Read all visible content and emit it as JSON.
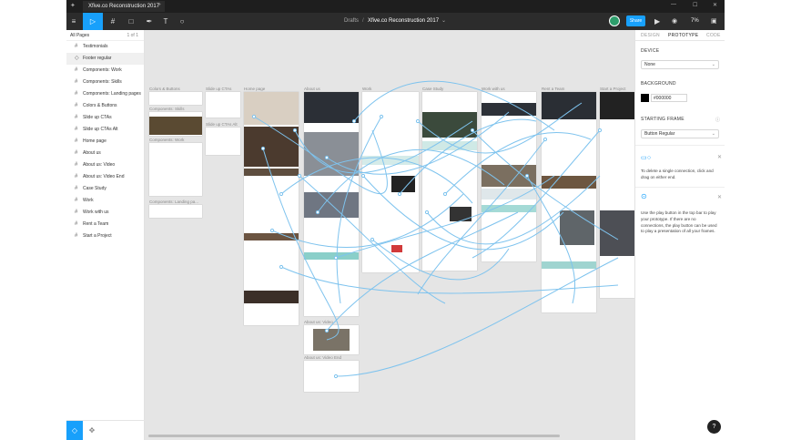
{
  "titlebar": {
    "tab_title": "Xfive.co Reconstruction 2017",
    "new_tab": "+",
    "minimize": "—",
    "maximize": "☐",
    "close": "✕"
  },
  "toolbar": {
    "breadcrumb_folder": "Drafts",
    "breadcrumb_sep": "/",
    "file_name": "Xfive.co Reconstruction 2017",
    "file_caret": "⌄",
    "share_label": "Share",
    "zoom": "7%"
  },
  "left_panel": {
    "pages_label": "All Pages",
    "pages_count": "1 of 1",
    "layers": [
      {
        "label": "Testimonials"
      },
      {
        "label": "Footer regular"
      },
      {
        "label": "Components: Work"
      },
      {
        "label": "Components: Skills"
      },
      {
        "label": "Components: Landing pages"
      },
      {
        "label": "Colors & Buttons"
      },
      {
        "label": "Slide up CTAs"
      },
      {
        "label": "Slide up CTAs Alt"
      },
      {
        "label": "Home page"
      },
      {
        "label": "About us"
      },
      {
        "label": "About us: Video"
      },
      {
        "label": "About us: Video End"
      },
      {
        "label": "Case Study"
      },
      {
        "label": "Work"
      },
      {
        "label": "Work with us"
      },
      {
        "label": "Rent a Team"
      },
      {
        "label": "Start a Project"
      }
    ]
  },
  "canvas": {
    "frame_labels": {
      "colors_buttons": "Colors & Buttons",
      "slide_up": "Slide up CTAs",
      "slide_up_alt": "Slide up CTAs Alt",
      "home": "Home page",
      "about": "About us",
      "work": "Work",
      "case_study": "Case Study",
      "work_with_us": "Work with us",
      "rent": "Rent a Team",
      "start": "Start a Project",
      "comp_skills": "Components: Skills",
      "comp_work": "Components: Work",
      "comp_landing": "Components: Landing pa...",
      "about_video": "About us: Video",
      "about_video_end": "About us: Video End"
    }
  },
  "right_panel": {
    "tabs": [
      "DESIGN",
      "PROTOTYPE",
      "CODE"
    ],
    "device_label": "DEVICE",
    "device_value": "None",
    "background_label": "BACKGROUND",
    "background_hex": "#000000",
    "starting_frame_label": "STARTING FRAME",
    "starting_frame_value": "Button Regular",
    "hint1": "To delete a single connection, click and drag on either end.",
    "hint2": "Use the play button in the top bar to play your prototype. If there are no connections, the play button can be used to play a presentation of all your frames."
  },
  "help_label": "?",
  "colors": {
    "accent": "#18a0fb",
    "wire": "#7ec3ee",
    "toolbar": "#2c2c2c",
    "titlebar": "#1e1e1e"
  }
}
